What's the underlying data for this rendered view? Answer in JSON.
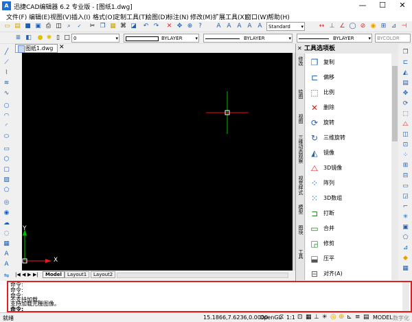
{
  "window": {
    "icon_letter": "A",
    "title": "迅捷CAD编辑器 6.2 专业版 - [图纸1.dwg]",
    "min": "—",
    "max": "☐",
    "close": "✕"
  },
  "menu": [
    "文件(F)",
    "编辑(E)",
    "视图(V)",
    "插入(I)",
    "格式(O)",
    "定制工具(T)",
    "绘图(D)",
    "标注(N)",
    "修改(M)",
    "扩展工具(X)",
    "窗口(W)",
    "帮助(H)"
  ],
  "toolbar": {
    "text_style": "Standard"
  },
  "properties_bar": {
    "layer": "0",
    "color": "BYLAYER",
    "linetype": "BYLAYER",
    "lineweight": "BYLAYER",
    "plotstyle": "BYCOLOR"
  },
  "document_tab": {
    "name": "图纸1.dwg",
    "close": "✕"
  },
  "canvas": {
    "background": "#000000",
    "crosshair_color": "#ff0000",
    "axis_y": "Y",
    "axis_x": "X"
  },
  "layout_tabs": [
    "Model",
    "Layout1",
    "Layout2"
  ],
  "palette": {
    "title": "工具选项板",
    "vertical_tabs": [
      "修改",
      "绘图",
      "视图",
      "三维动态观察",
      "视觉样式",
      "模型",
      "图块",
      "工具"
    ],
    "items": [
      {
        "label": "复制",
        "icon": "copy-icon"
      },
      {
        "label": "偏移",
        "icon": "offset-icon"
      },
      {
        "label": "比例",
        "icon": "scale-icon"
      },
      {
        "label": "删除",
        "icon": "erase-icon"
      },
      {
        "label": "旋转",
        "icon": "rotate-icon"
      },
      {
        "label": "三维旋转",
        "icon": "3d-rotate-icon"
      },
      {
        "label": "镜像",
        "icon": "mirror-icon"
      },
      {
        "label": "3D镜像",
        "icon": "3d-mirror-icon"
      },
      {
        "label": "阵列",
        "icon": "array-icon"
      },
      {
        "label": "3D数组",
        "icon": "3d-array-icon"
      },
      {
        "label": "打断",
        "icon": "break-icon"
      },
      {
        "label": "合并",
        "icon": "join-icon"
      },
      {
        "label": "修剪",
        "icon": "trim-icon"
      },
      {
        "label": "压平",
        "icon": "flatten-icon"
      },
      {
        "label": "对齐(A)",
        "icon": "align-icon"
      }
    ]
  },
  "command": {
    "history": [
      "命令:",
      "命令:",
      "命令:",
      "不支持加载。",
      "支持加载光栅图像。"
    ],
    "prompt": "命令:"
  },
  "status": {
    "left": "就绪",
    "coords": "15.1866,7.6236,0.0000",
    "opengl": "OpenGL",
    "scale": "1:1",
    "model": "MODEL",
    "digitizer": "数字化"
  }
}
